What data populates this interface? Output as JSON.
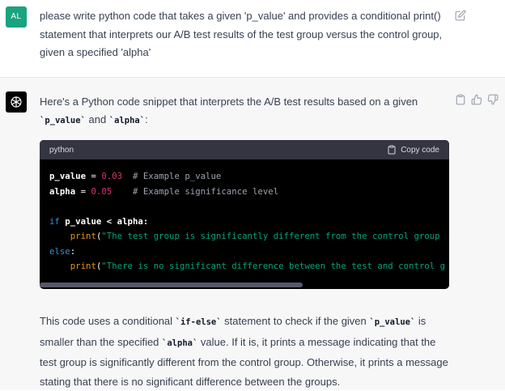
{
  "user": {
    "initials": "AL",
    "message": "please write python code that takes a given 'p_value' and provides a conditional print() statement that interprets our A/B test results of the test group versus the control group, given a specified 'alpha'"
  },
  "assistant": {
    "intro_pre": "Here's a Python code snippet that interprets the A/B test results based on a given ",
    "intro_code1": "`p_value`",
    "intro_and": " and ",
    "intro_code2": "`alpha`",
    "intro_post": ":",
    "code_block": {
      "language": "python",
      "copy_label": "Copy code",
      "lines": {
        "l1_var": "p_value",
        "l1_eq": " = ",
        "l1_num": "0.03",
        "l1_comment": "  # Example p_value",
        "l2_var": "alpha",
        "l2_eq": " = ",
        "l2_num": "0.05",
        "l2_comment": "    # Example significance level",
        "l4_kw": "if",
        "l4_rest": " p_value < alpha:",
        "l5_fn": "print",
        "l5_paren": "(",
        "l5_str": "\"The test group is significantly different from the control group",
        "l6_kw": "else",
        "l6_rest": ":",
        "l7_fn": "print",
        "l7_paren": "(",
        "l7_str": "\"There is no significant difference between the test and control g"
      }
    },
    "summary": {
      "s1": "This code uses a conditional ",
      "c1": "`if-else`",
      "s2": " statement to check if the given ",
      "c2": "`p_value`",
      "s3": " is smaller than the specified ",
      "c3": "`alpha`",
      "s4": " value. If it is, it prints a message indicating that the test group is significantly different from the control group. Otherwise, it prints a message stating that there is no significant difference between the groups."
    }
  },
  "icons": {
    "edit": "edit-icon",
    "copy": "clipboard-icon",
    "thumbs_up": "thumbs-up-icon",
    "thumbs_down": "thumbs-down-icon",
    "logo": "openai-logo-icon"
  },
  "colors": {
    "user_avatar": "#19a37f",
    "assistant_bg": "#f7f7f8",
    "code_bg": "#000000",
    "code_header_bg": "#343541"
  }
}
